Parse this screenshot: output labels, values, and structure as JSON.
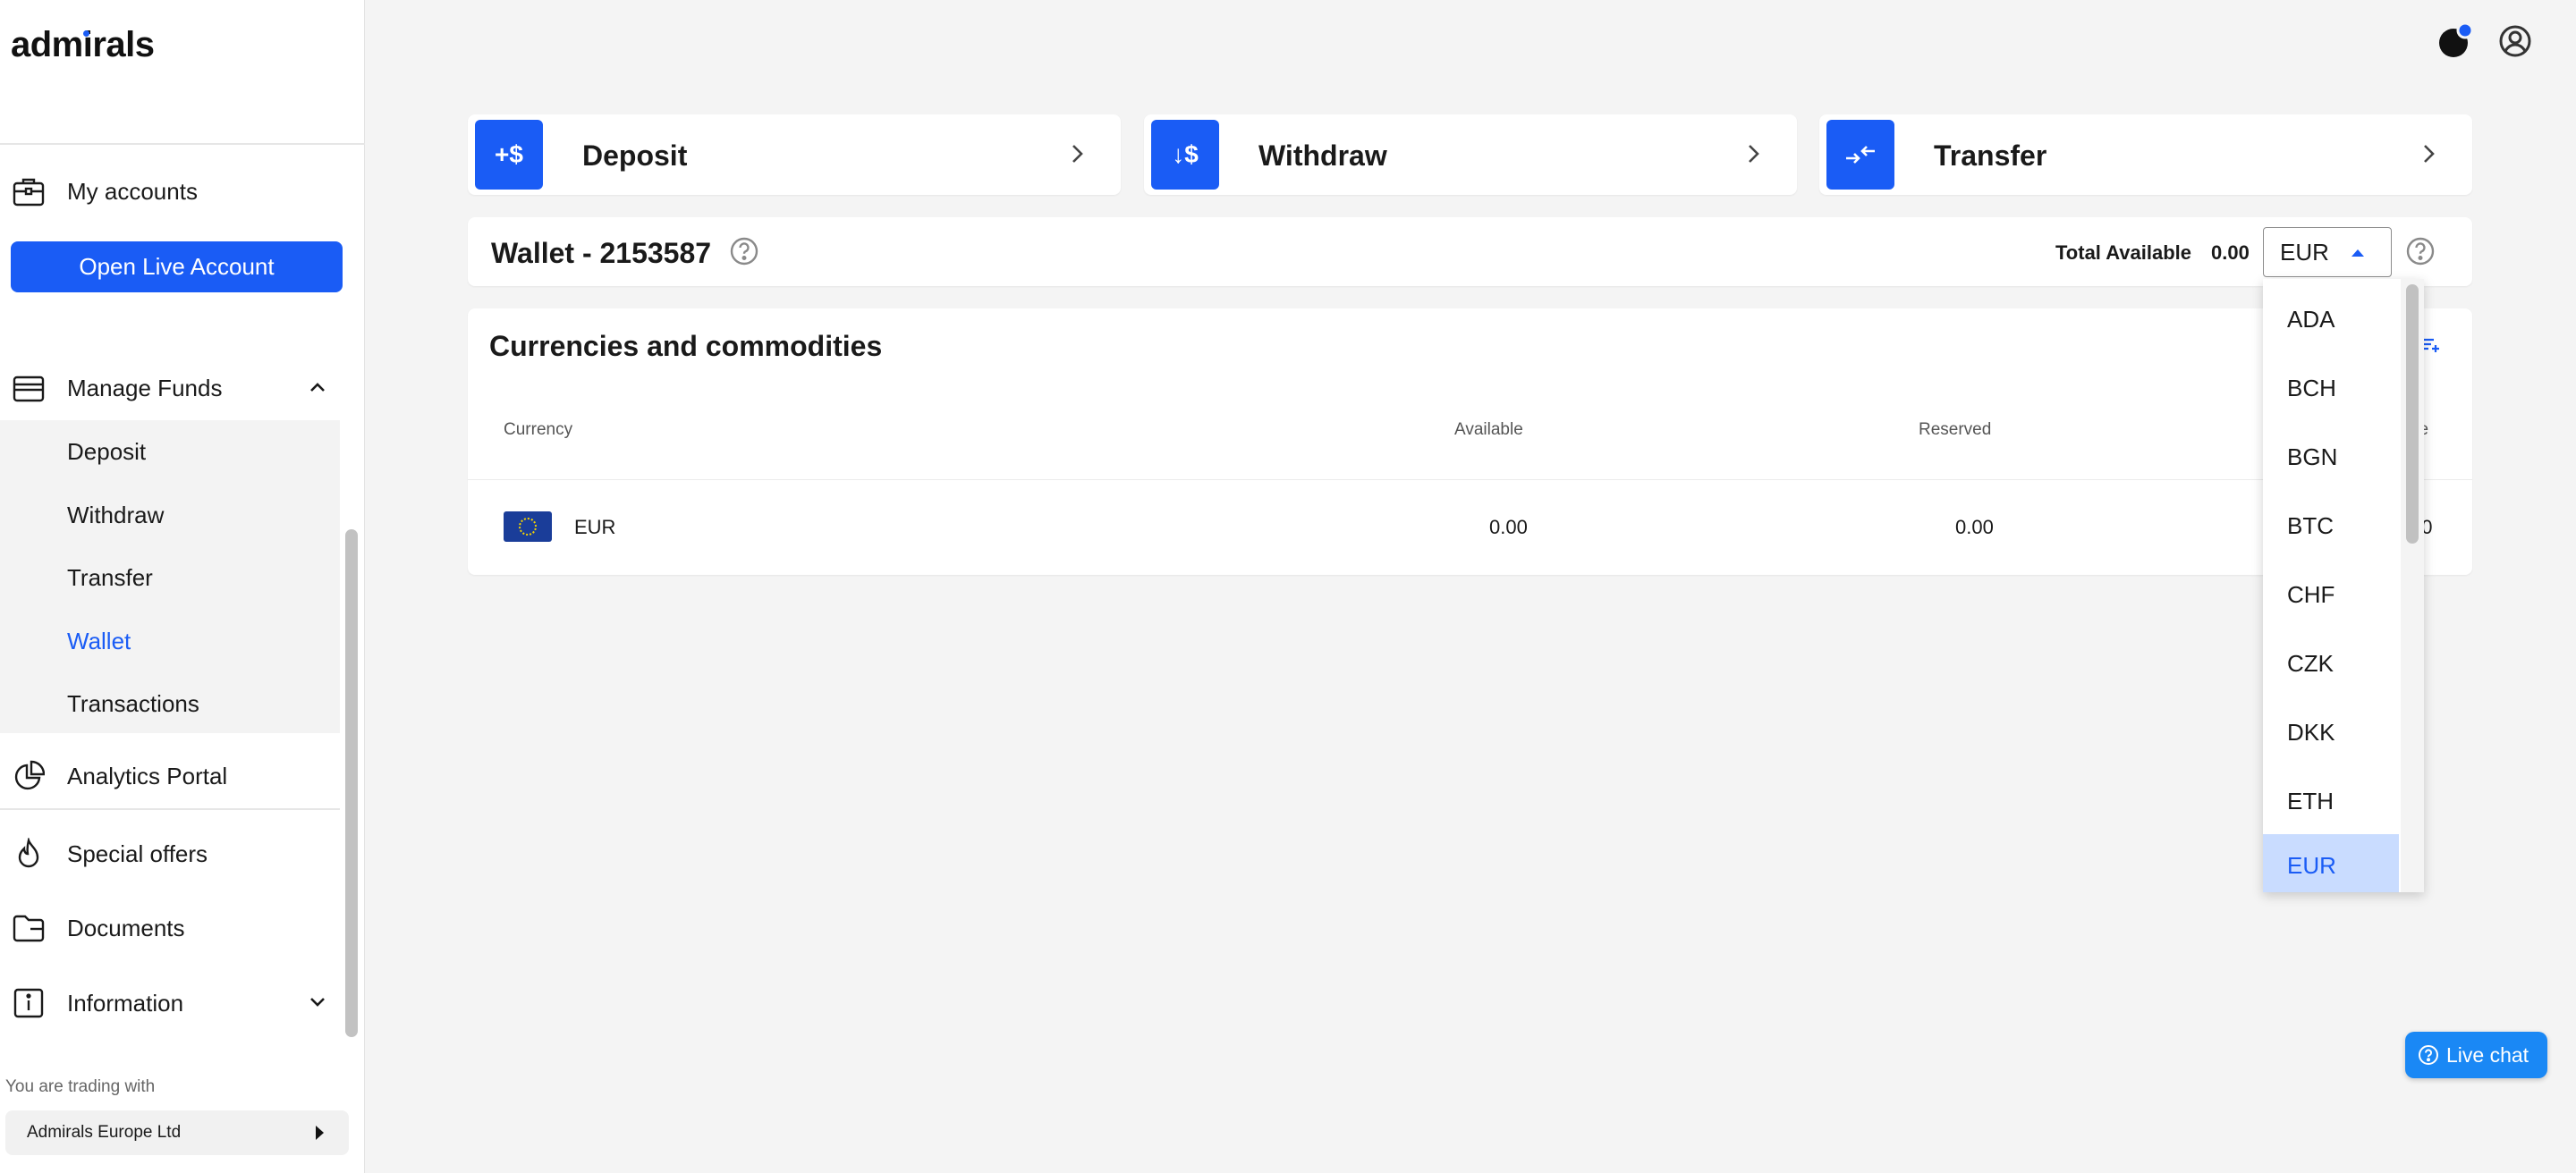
{
  "brand": {
    "logo_text": "admirals"
  },
  "sidebar": {
    "my_accounts": "My accounts",
    "open_live_account": "Open Live Account",
    "manage_funds": "Manage Funds",
    "sub_items": [
      "Deposit",
      "Withdraw",
      "Transfer",
      "Wallet",
      "Transactions"
    ],
    "active_sub_item": "Wallet",
    "analytics_portal": "Analytics Portal",
    "special_offers": "Special offers",
    "documents": "Documents",
    "information": "Information",
    "trading_with_label": "You are trading with",
    "entity": "Admirals Europe Ltd"
  },
  "actions": {
    "deposit": {
      "label": "Deposit",
      "icon_text": "+$"
    },
    "withdraw": {
      "label": "Withdraw",
      "icon_text": "↓$"
    },
    "transfer": {
      "label": "Transfer"
    }
  },
  "wallet": {
    "title": "Wallet - 2153587",
    "total_available_label": "Total Available",
    "total_available_value": "0.00",
    "selected_currency": "EUR",
    "currency_options": [
      "ADA",
      "BCH",
      "BGN",
      "BTC",
      "CHF",
      "CZK",
      "DKK",
      "ETH",
      "EUR"
    ]
  },
  "table": {
    "title": "Currencies and commodities",
    "headers": {
      "currency": "Currency",
      "available": "Available",
      "reserved": "Reserved",
      "balance_tail": "ce"
    },
    "rows": [
      {
        "currency": "EUR",
        "available": "0.00",
        "reserved": "0.00",
        "balance_tail": "00"
      }
    ]
  },
  "live_chat": {
    "label": "Live chat"
  },
  "colors": {
    "accent": "#1a5cf5",
    "live_chat": "#1a88f5",
    "selected_option_bg": "#c9dcff"
  },
  "icons": {
    "sidebar": [
      "briefcase-icon",
      "wallet-icon",
      "pie-chart-icon",
      "flame-icon",
      "folder-icon",
      "info-icon"
    ],
    "top_bar": [
      "notification-icon",
      "user-icon"
    ]
  }
}
